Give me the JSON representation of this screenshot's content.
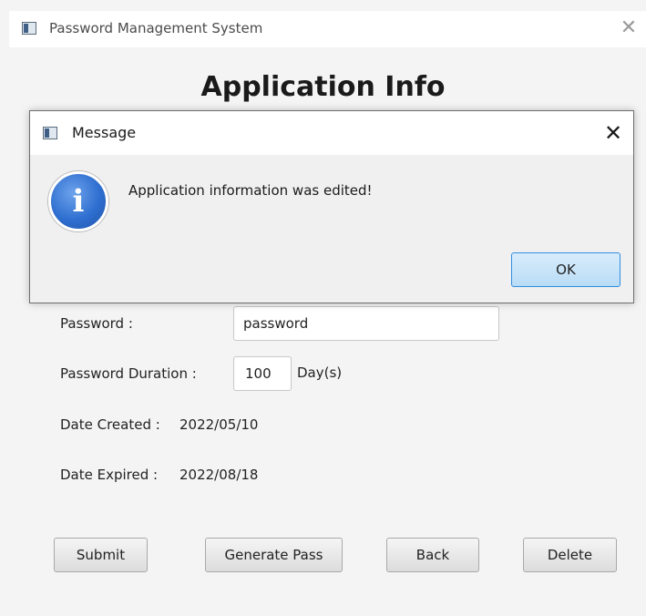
{
  "window": {
    "title": "Password Management System",
    "close_glyph": "✕",
    "app_icon": "app-window-icon"
  },
  "heading": "Application Info",
  "form": {
    "password_label": "Password :",
    "password_value": "password",
    "duration_label": "Password Duration :",
    "duration_value": "100",
    "duration_unit": "Day(s)",
    "created_label": "Date Created :",
    "created_value": "2022/05/10",
    "expired_label": "Date Expired :",
    "expired_value": "2022/08/18"
  },
  "buttons": {
    "submit": "Submit",
    "generate": "Generate Pass",
    "back": "Back",
    "delete": "Delete"
  },
  "dialog": {
    "title": "Message",
    "close_glyph": "✕",
    "icon": "info-icon",
    "icon_glyph": "i",
    "message": "Application information was edited!",
    "ok": "OK",
    "colors": {
      "icon_blue": "#2f6fd0",
      "ok_border": "#2f8ee0",
      "ok_fill": "#c9e4f9"
    }
  }
}
